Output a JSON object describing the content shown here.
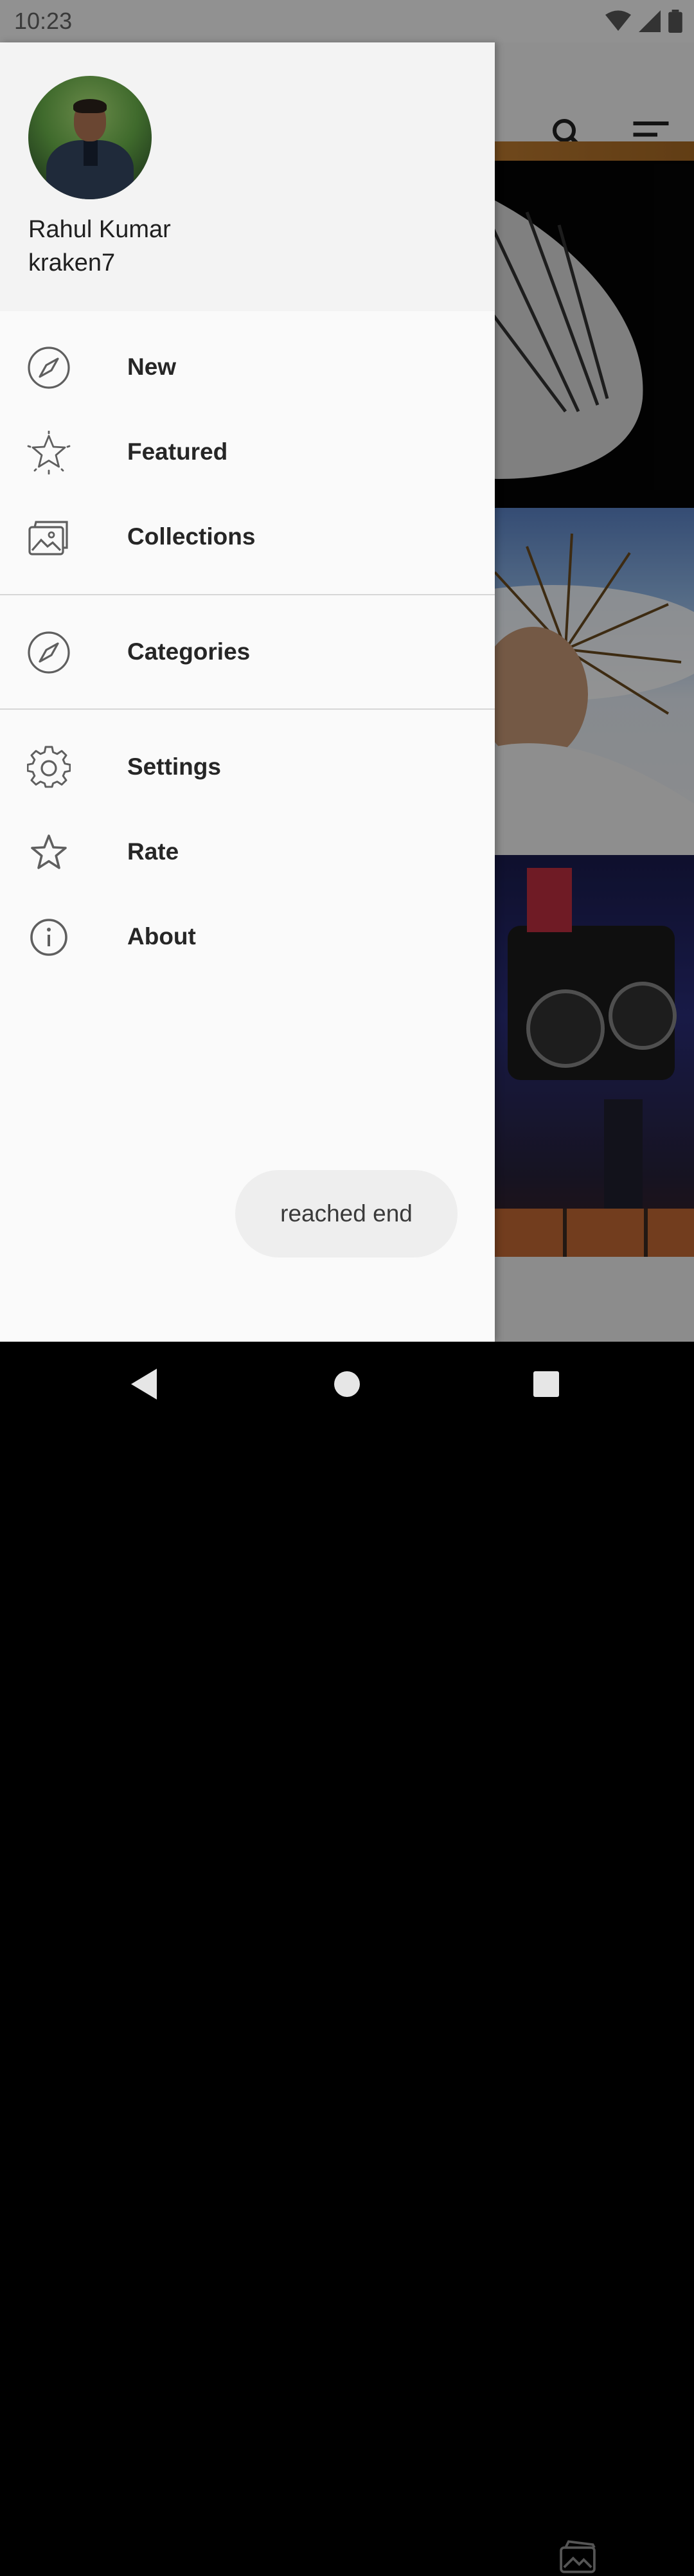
{
  "status_bar": {
    "time": "10:23",
    "icons": [
      "wifi-icon",
      "signal-icon",
      "battery-icon"
    ]
  },
  "background_app": {
    "toolbar_icons": [
      "search-icon",
      "sort-icon"
    ],
    "bottom_nav_icon": "collections-icon"
  },
  "drawer": {
    "header": {
      "name": "Rahul Kumar",
      "username": "kraken7"
    },
    "sections": [
      [
        {
          "label": "New",
          "icon": "compass-icon"
        },
        {
          "label": "Featured",
          "icon": "star-badge-icon"
        },
        {
          "label": "Collections",
          "icon": "collections-icon"
        }
      ],
      [
        {
          "label": "Categories",
          "icon": "compass-icon"
        }
      ],
      [
        {
          "label": "Settings",
          "icon": "gear-icon"
        },
        {
          "label": "Rate",
          "icon": "star-icon"
        },
        {
          "label": "About",
          "icon": "info-icon"
        }
      ]
    ]
  },
  "toast": {
    "text": "reached end"
  },
  "nav_bar": {
    "buttons": [
      "back-icon",
      "home-icon",
      "recents-icon"
    ]
  },
  "colors": {
    "drawer_bg": "#fafafa",
    "header_bg": "#f3f3f3",
    "icon": "#5f5f5f",
    "text": "#262626",
    "scrim": "rgba(0,0,0,0.42)"
  }
}
